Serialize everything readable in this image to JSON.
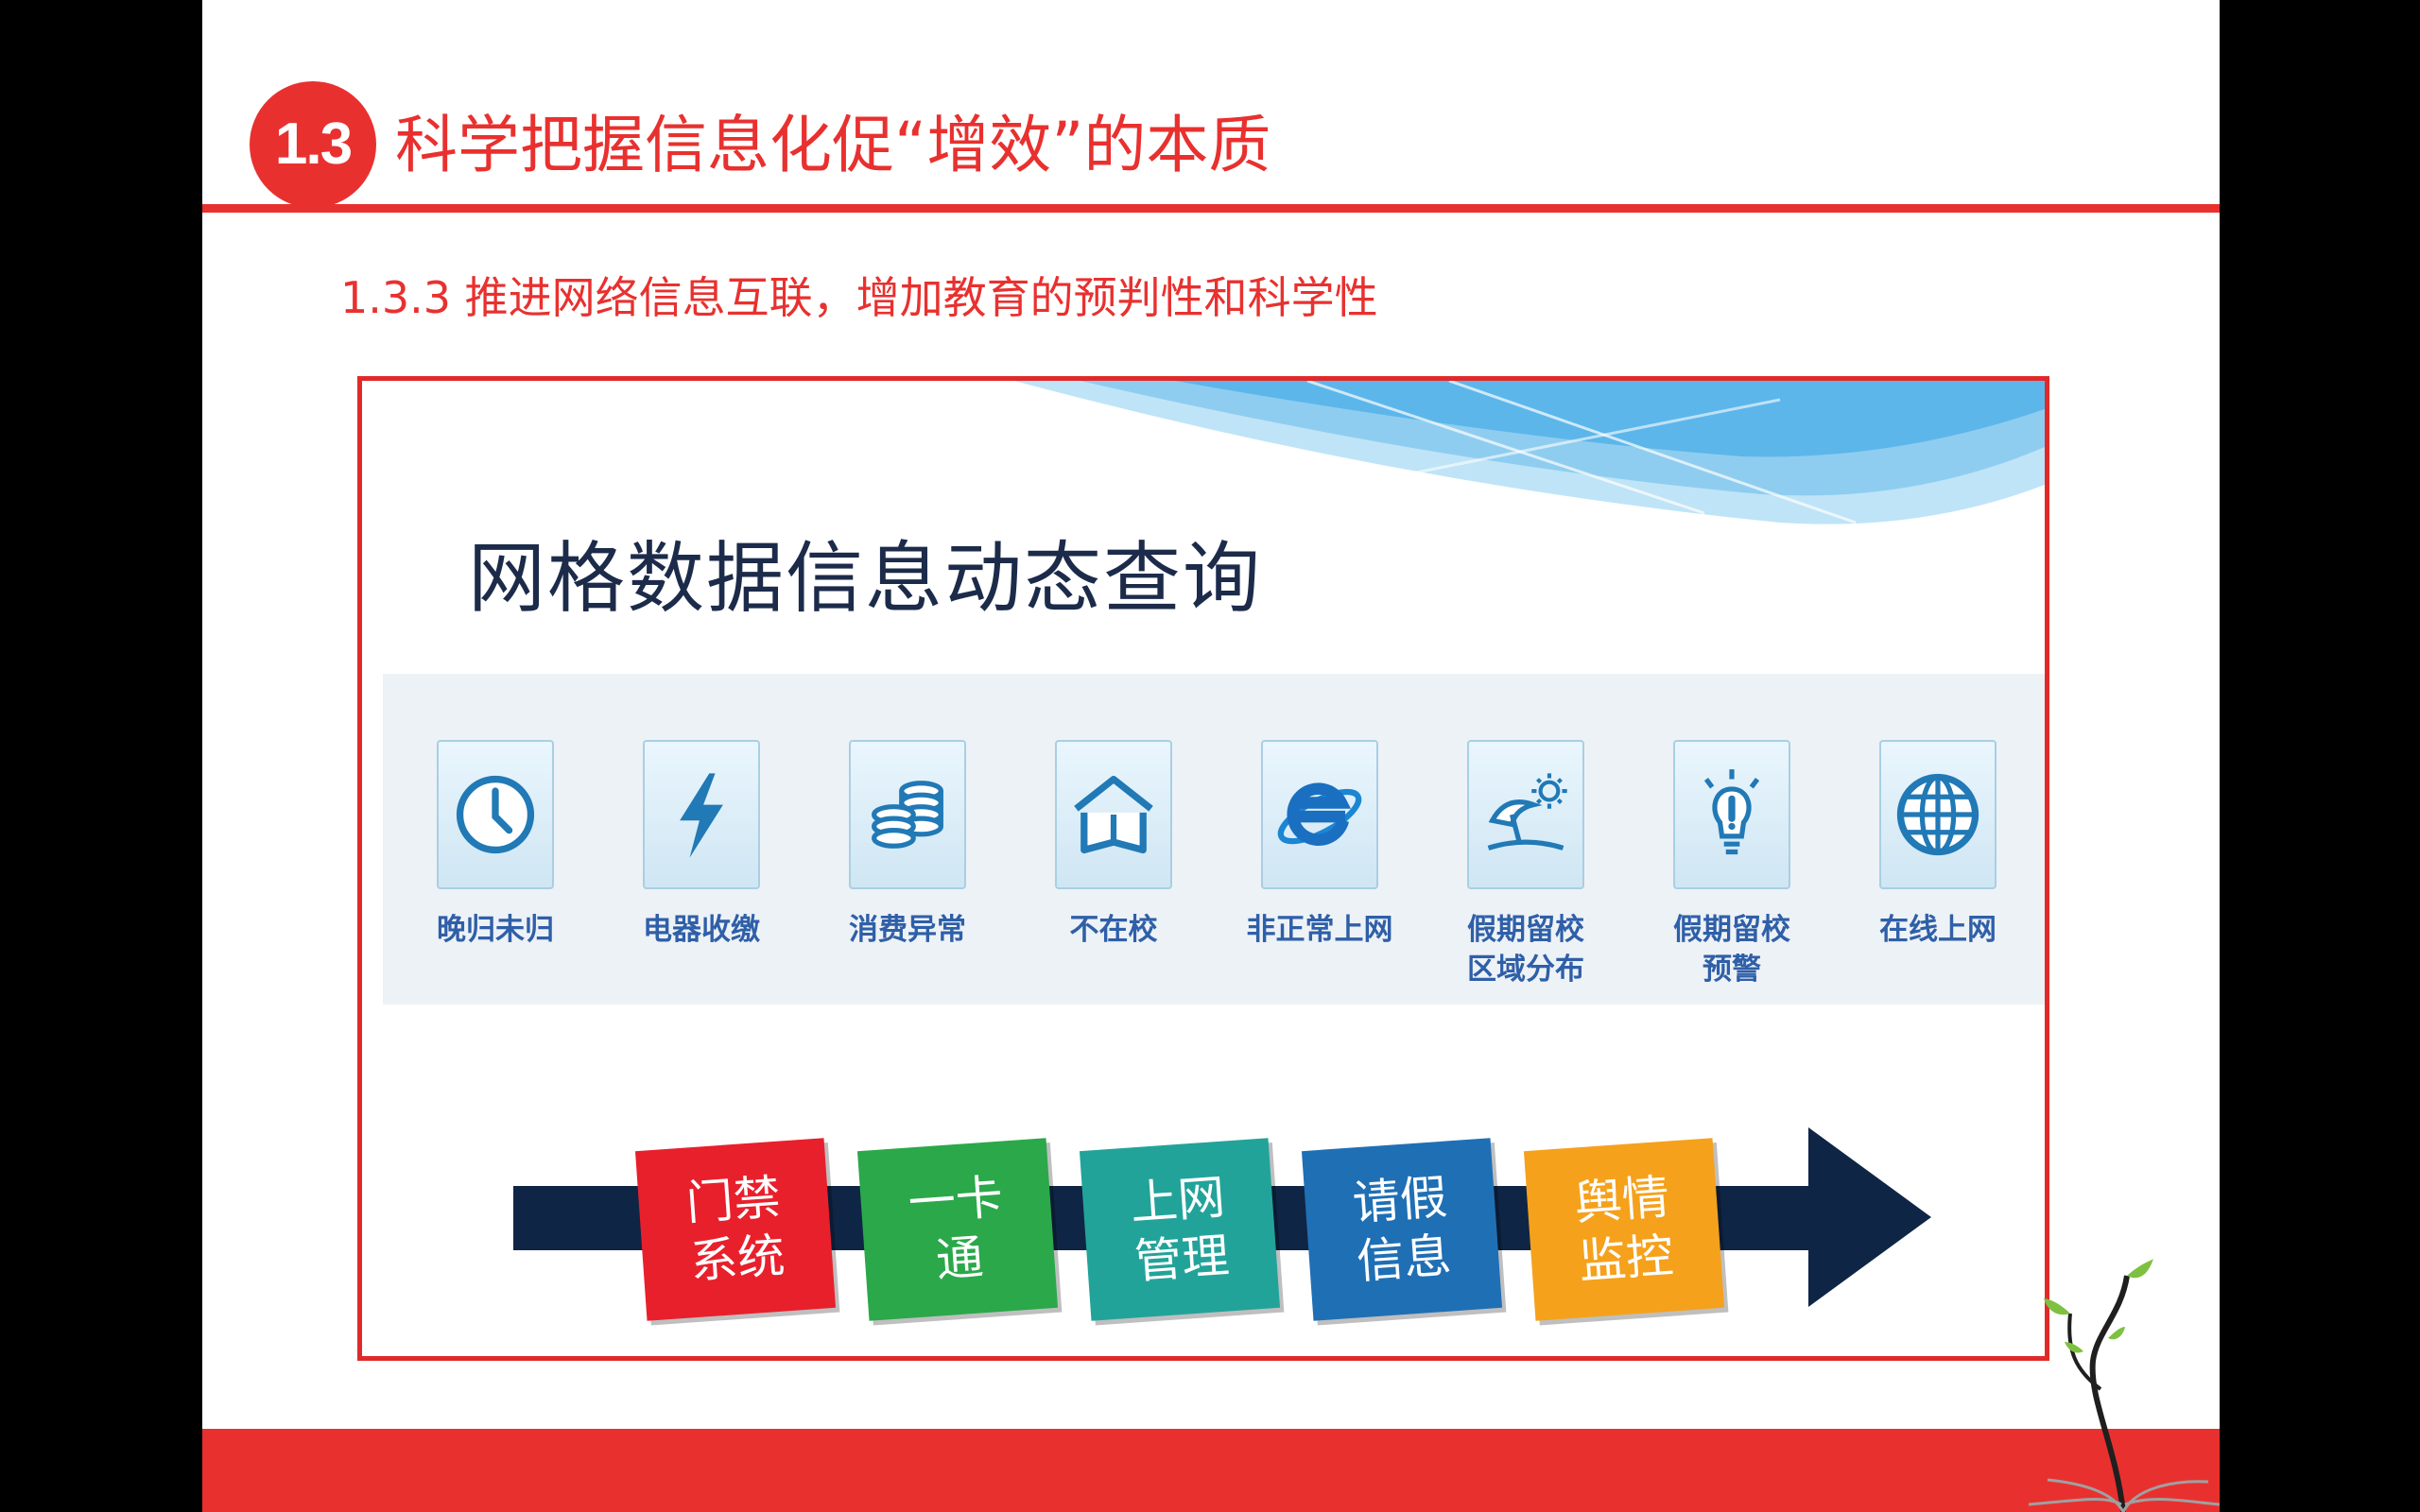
{
  "slide": {
    "section_number": "1.3",
    "section_title": "科学把握信息化促“增效”的本质",
    "subtitle": "1.3.3 推进网络信息互联，增加教育的预判性和科学性"
  },
  "panel": {
    "title": "网格数据信息动态查询",
    "icons": [
      {
        "label": "晚归未归",
        "icon": "clock-icon"
      },
      {
        "label": "电器收缴",
        "icon": "lightning-icon"
      },
      {
        "label": "消费异常",
        "icon": "coins-icon"
      },
      {
        "label": "不在校",
        "icon": "house-book-icon"
      },
      {
        "label": "非正常上网",
        "icon": "internet-explorer-icon"
      },
      {
        "label": "假期留校\n区域分布",
        "icon": "beach-sun-icon"
      },
      {
        "label": "假期留校\n预警",
        "icon": "lightbulb-alert-icon"
      },
      {
        "label": "在线上网",
        "icon": "globe-icon"
      }
    ],
    "process_steps": [
      {
        "label": "门禁\n系统",
        "color": "#e8202c"
      },
      {
        "label": "一卡\n通",
        "color": "#2ba84a"
      },
      {
        "label": "上网\n管理",
        "color": "#22a39a"
      },
      {
        "label": "请假\n信息",
        "color": "#1f6fb5"
      },
      {
        "label": "舆情\n监控",
        "color": "#f5a11c"
      }
    ],
    "arrow_color": "#0f2545"
  },
  "colors": {
    "accent": "#e8312f",
    "frame_border": "#e02a2a",
    "icon_label": "#2f5fa8"
  }
}
